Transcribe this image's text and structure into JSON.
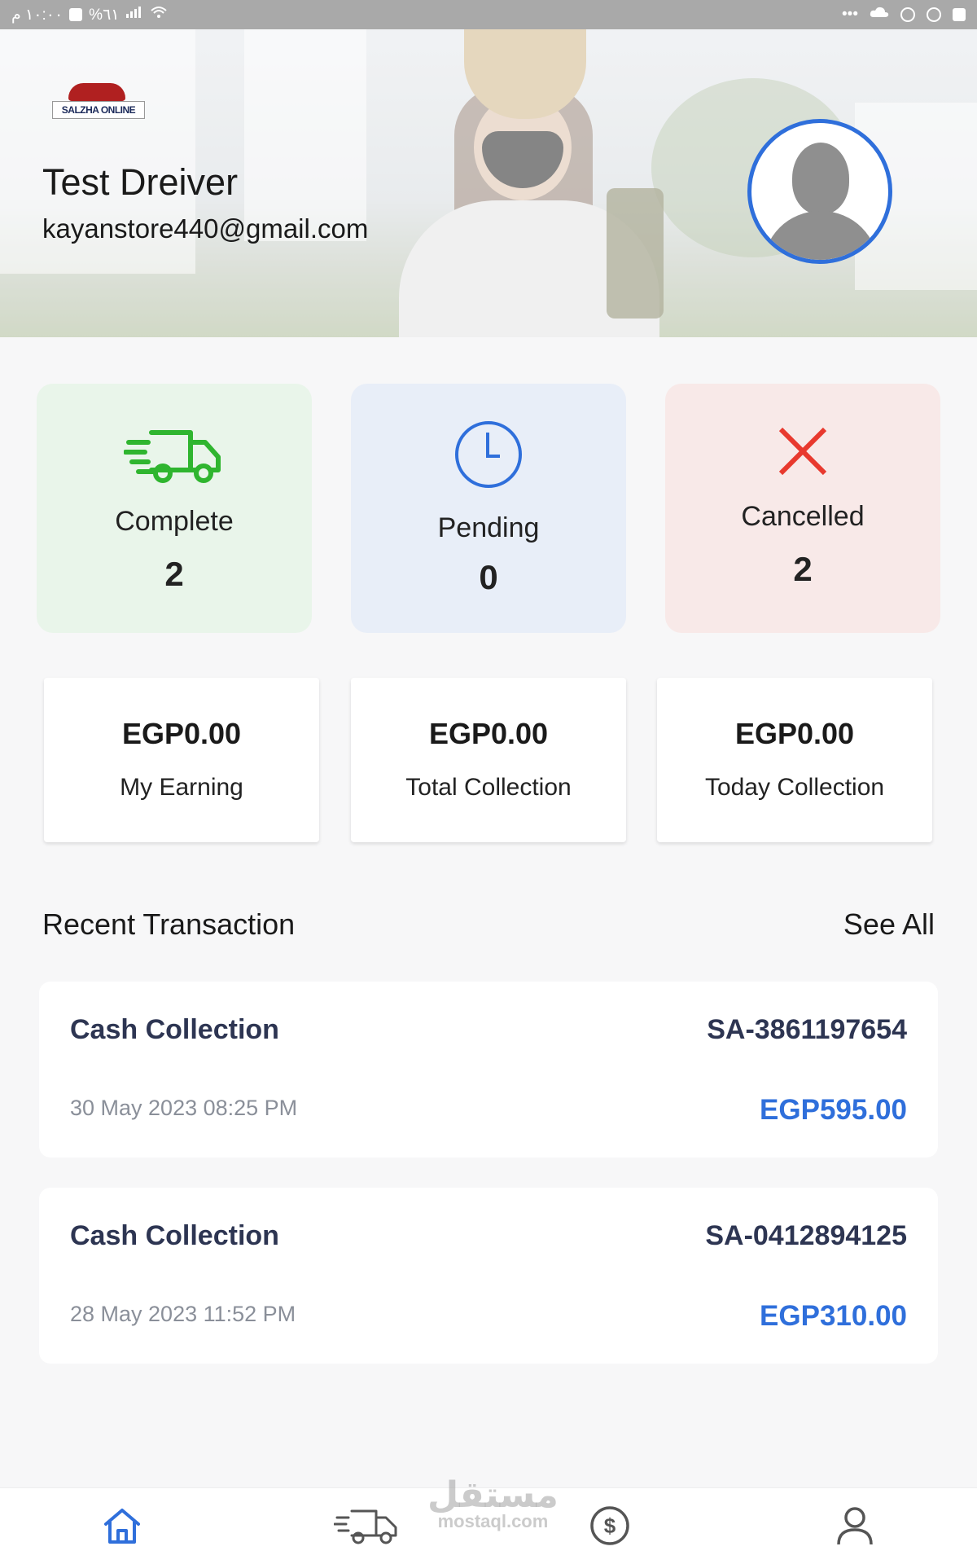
{
  "status_bar": {
    "time": "١٠:٠٠ م",
    "battery": "%٦١"
  },
  "header": {
    "logo_text": "SALZHA ONLINE",
    "driver_name": "Test Dreiver",
    "driver_email": "kayanstore440@gmail.com"
  },
  "stats": {
    "complete": {
      "label": "Complete",
      "count": "2"
    },
    "pending": {
      "label": "Pending",
      "count": "0"
    },
    "cancelled": {
      "label": "Cancelled",
      "count": "2"
    }
  },
  "earnings": {
    "my_earning": {
      "amount": "EGP0.00",
      "label": "My Earning"
    },
    "total_collection": {
      "amount": "EGP0.00",
      "label": "Total Collection"
    },
    "today_collection": {
      "amount": "EGP0.00",
      "label": "Today Collection"
    }
  },
  "recent": {
    "title": "Recent Transaction",
    "see_all": "See All",
    "transactions": [
      {
        "title": "Cash Collection",
        "ref": "SA-3861197654",
        "date": "30 May 2023 08:25 PM",
        "amount": "EGP595.00"
      },
      {
        "title": "Cash Collection",
        "ref": "SA-0412894125",
        "date": "28 May 2023 11:52 PM",
        "amount": "EGP310.00"
      }
    ]
  },
  "watermark": {
    "arabic": "مستقل",
    "latin": "mostaql.com"
  },
  "bottom_nav": [
    {
      "icon": "home-icon",
      "active": true
    },
    {
      "icon": "truck-icon",
      "active": false
    },
    {
      "icon": "dollar-icon",
      "active": false
    },
    {
      "icon": "profile-icon",
      "active": false
    }
  ],
  "colors": {
    "accent": "#2f6fdb",
    "complete_icon": "#2fb52f",
    "cancel_icon": "#e8392e"
  }
}
